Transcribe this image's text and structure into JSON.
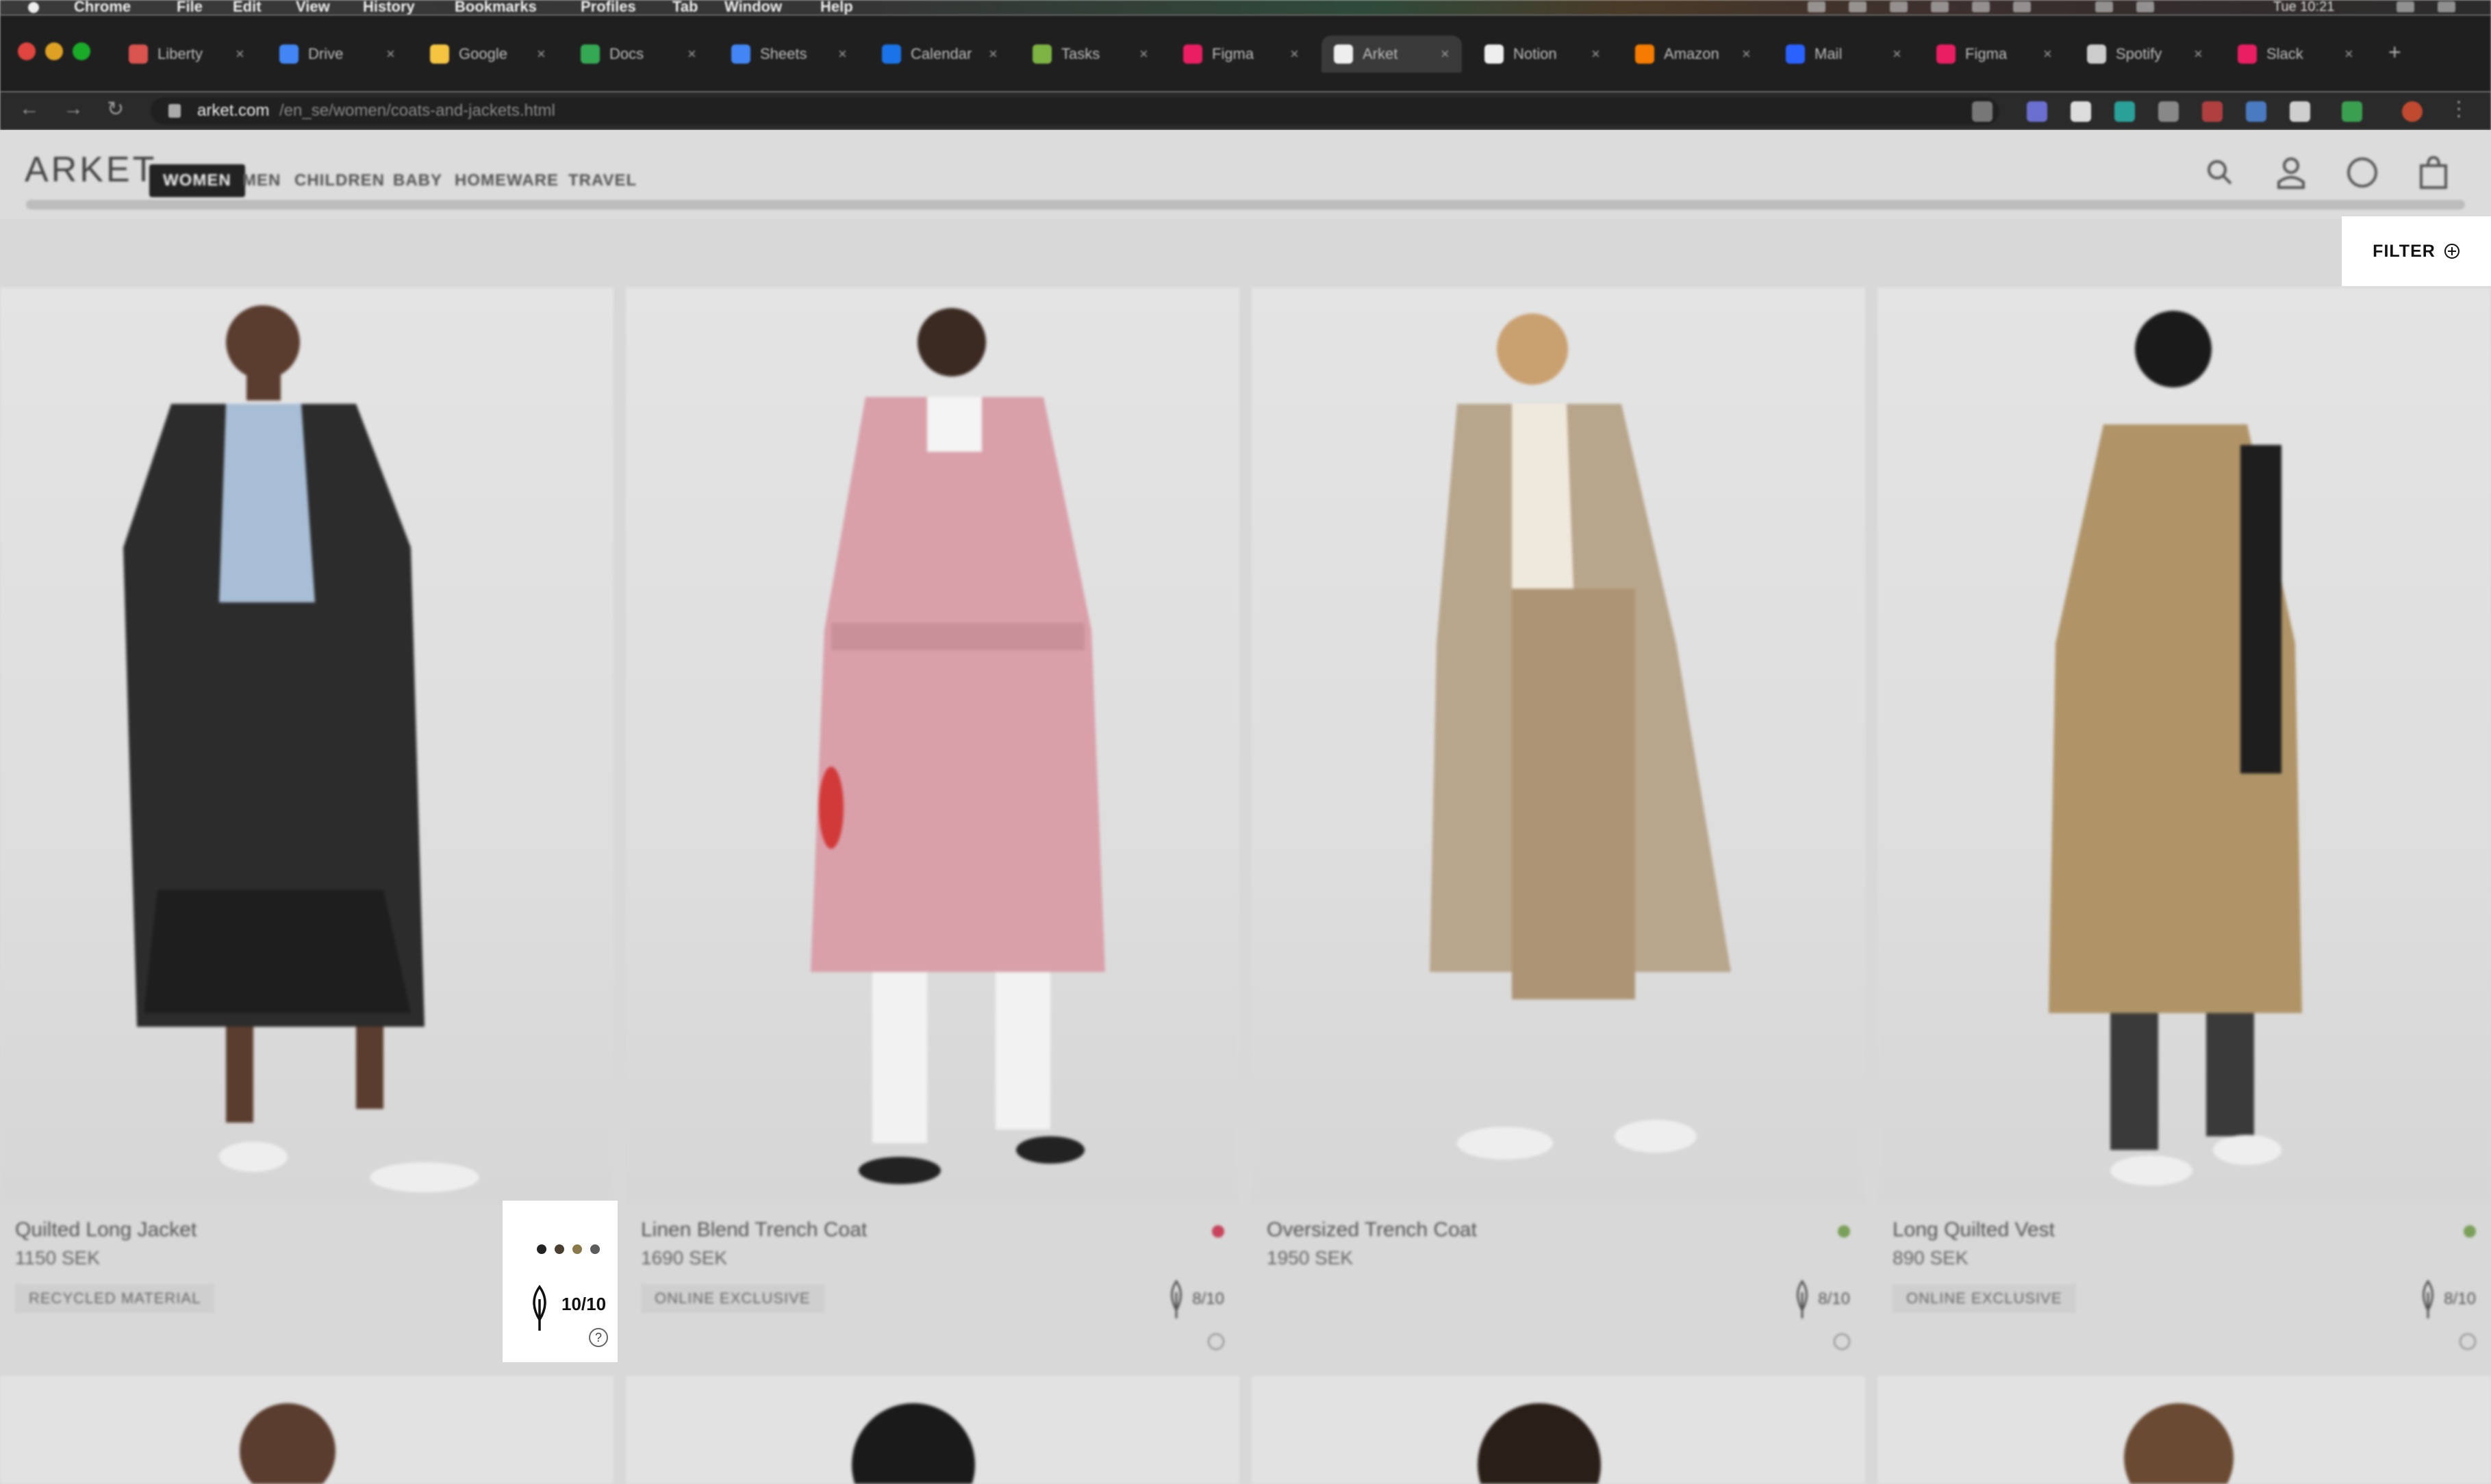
{
  "menubar": {
    "items": [
      "Chrome",
      "File",
      "Edit",
      "View",
      "History",
      "Bookmarks",
      "Profiles",
      "Tab",
      "Window",
      "Help"
    ],
    "clock": "Tue 10:21"
  },
  "browser": {
    "tabs": [
      {
        "title": "Liberty",
        "color": "#d9534f"
      },
      {
        "title": "Drive",
        "color": "#4285f4"
      },
      {
        "title": "Google",
        "color": "#f5c542"
      },
      {
        "title": "Docs",
        "color": "#34a853"
      },
      {
        "title": "Sheets",
        "color": "#4285f4"
      },
      {
        "title": "Calendar",
        "color": "#1a73e8"
      },
      {
        "title": "Tasks",
        "color": "#7cb342"
      },
      {
        "title": "Figma",
        "color": "#e91e63"
      },
      {
        "title": "Arket",
        "color": "#eeeeee"
      },
      {
        "title": "Notion",
        "color": "#eeeeee"
      },
      {
        "title": "Amazon",
        "color": "#f57c00"
      },
      {
        "title": "Mail",
        "color": "#2962ff"
      },
      {
        "title": "Figma",
        "color": "#e91e63"
      },
      {
        "title": "Spotify",
        "color": "#cccccc"
      },
      {
        "title": "Slack",
        "color": "#e91e63"
      }
    ],
    "active_tab": 8,
    "url_domain": "arket.com",
    "url_path": "/en_se/women/coats-and-jackets.html"
  },
  "site": {
    "logo": "ARKET",
    "nav": [
      "WOMEN",
      "MEN",
      "CHILDREN",
      "BABY",
      "HOMEWARE",
      "TRAVEL"
    ],
    "nav_active": 0,
    "filter_label": "FILTER"
  },
  "products": [
    {
      "name": "Quilted Long Jacket",
      "price": "1150 SEK",
      "tag": "RECYCLED MATERIAL",
      "score": "10/10"
    },
    {
      "name": "Linen Blend Trench Coat",
      "price": "1690 SEK",
      "tag": "ONLINE EXCLUSIVE",
      "score": "8/10"
    },
    {
      "name": "Oversized Trench Coat",
      "price": "1950 SEK",
      "tag": "",
      "score": "8/10"
    },
    {
      "name": "Long Quilted Vest",
      "price": "890 SEK",
      "tag": "ONLINE EXCLUSIVE",
      "score": "8/10"
    }
  ],
  "popover": {
    "score": "10/10",
    "help": "?",
    "swatches": [
      "#222222",
      "#4a4030",
      "#8a7a4a",
      "#5c5c5c"
    ]
  }
}
